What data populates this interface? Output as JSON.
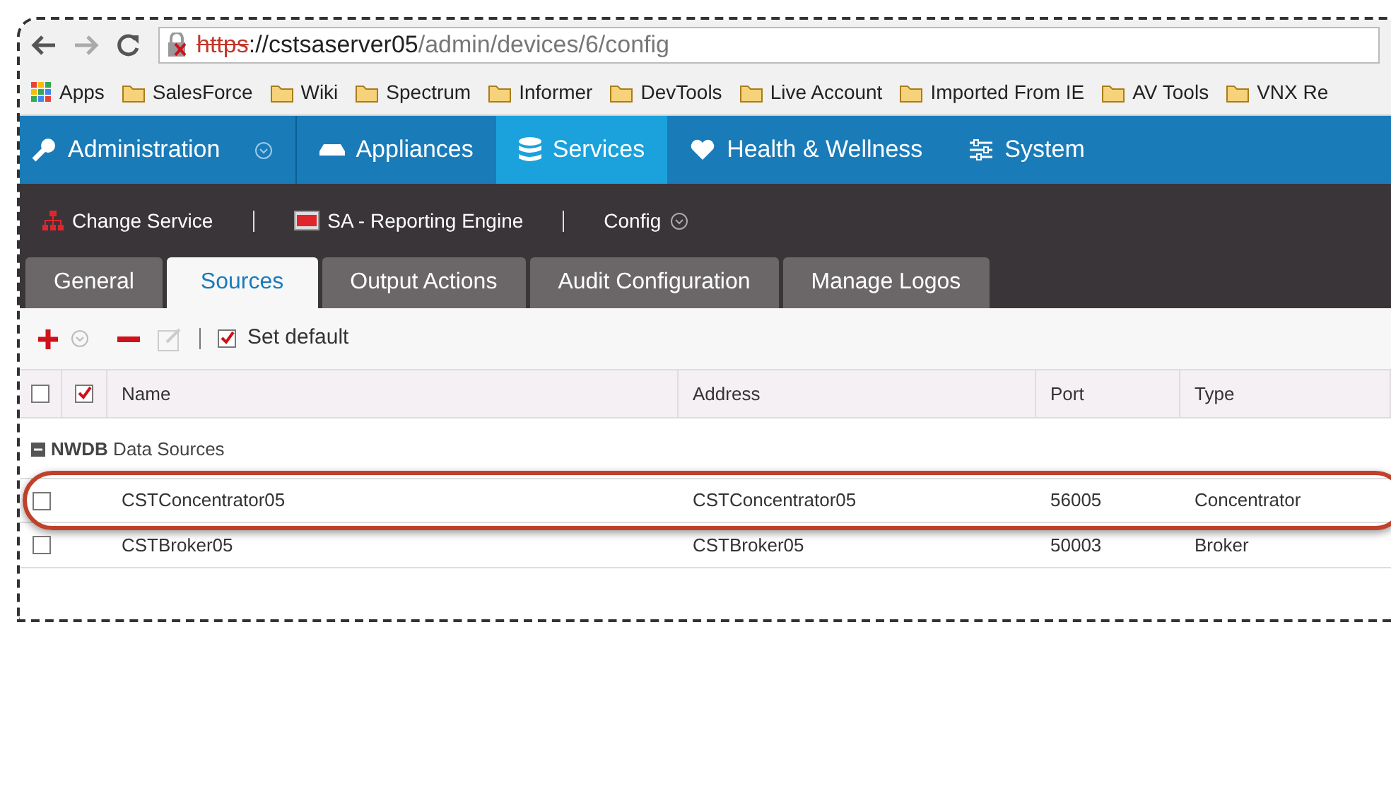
{
  "browser": {
    "url": {
      "scheme": "https",
      "host": "://cstsaserver05",
      "path": "/admin/devices/6/config",
      "insecure": true
    },
    "bookmarks": [
      {
        "label": "Apps",
        "kind": "apps"
      },
      {
        "label": "SalesForce",
        "kind": "folder"
      },
      {
        "label": "Wiki",
        "kind": "folder"
      },
      {
        "label": "Spectrum",
        "kind": "folder"
      },
      {
        "label": "Informer",
        "kind": "folder"
      },
      {
        "label": "DevTools",
        "kind": "folder"
      },
      {
        "label": "Live Account",
        "kind": "folder"
      },
      {
        "label": "Imported From IE",
        "kind": "folder"
      },
      {
        "label": "AV Tools",
        "kind": "folder"
      },
      {
        "label": "VNX Re",
        "kind": "folder"
      }
    ]
  },
  "nav": [
    {
      "label": "Administration",
      "selected": false,
      "dropdown": true
    },
    {
      "label": "Appliances",
      "selected": false,
      "dropdown": false
    },
    {
      "label": "Services",
      "selected": true,
      "dropdown": false
    },
    {
      "label": "Health & Wellness",
      "selected": false,
      "dropdown": false
    },
    {
      "label": "System",
      "selected": false,
      "dropdown": false
    }
  ],
  "subbar": [
    {
      "label": "Change Service"
    },
    {
      "label": "SA - Reporting Engine"
    },
    {
      "label": "Config"
    }
  ],
  "tabs": [
    {
      "label": "General",
      "selected": false
    },
    {
      "label": "Sources",
      "selected": true
    },
    {
      "label": "Output Actions",
      "selected": false
    },
    {
      "label": "Audit Configuration",
      "selected": false
    },
    {
      "label": "Manage Logos",
      "selected": false
    }
  ],
  "toolbar": {
    "set_default": {
      "label": "Set default",
      "checked": true
    }
  },
  "table": {
    "header_checkbox": {
      "checked": false
    },
    "header_flag": {
      "checked": true
    },
    "columns": [
      "Name",
      "Address",
      "Port",
      "Type"
    ],
    "groups": [
      {
        "name": "NWDB",
        "suffix": "Data Sources",
        "expanded": true,
        "rows": [
          {
            "checked": false,
            "highlighted": true,
            "cells": [
              "CSTConcentrator05",
              "CSTConcentrator05",
              "56005",
              "Concentrator"
            ]
          },
          {
            "checked": false,
            "highlighted": false,
            "cells": [
              "CSTBroker05",
              "CSTBroker05",
              "50003",
              "Broker"
            ]
          }
        ]
      }
    ]
  }
}
